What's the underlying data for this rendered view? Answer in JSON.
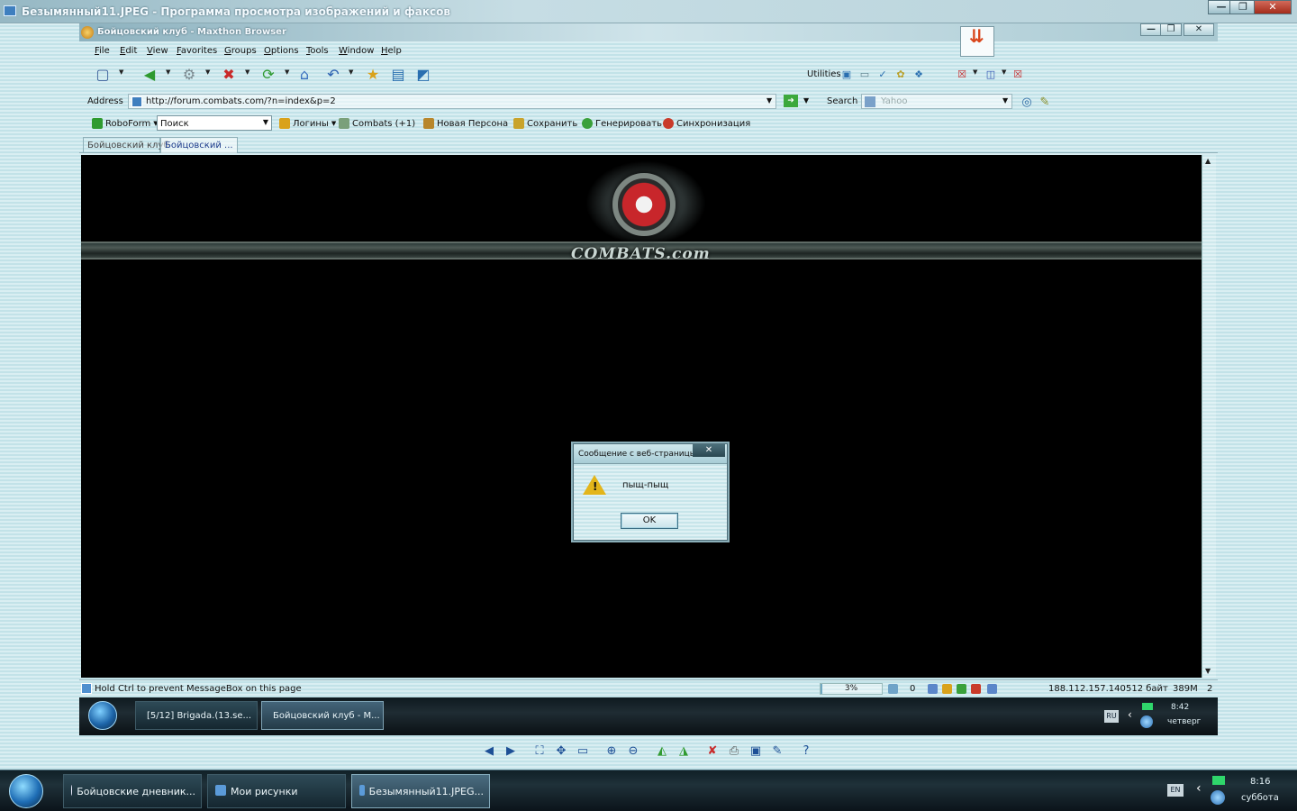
{
  "viewer": {
    "title": "Безымянный11.JPEG - Программа просмотра изображений и факсов",
    "controls": {
      "minimize": "—",
      "maximize": "❐",
      "close": "✕"
    }
  },
  "browser": {
    "title": "Бойцовский клуб - Maxthon Browser",
    "controls": {
      "minimize": "—",
      "maximize": "❐",
      "close": "✕"
    },
    "menu": [
      "File",
      "Edit",
      "View",
      "Favorites",
      "Groups",
      "Options",
      "Tools",
      "Window",
      "Help"
    ],
    "toolbar": {
      "utilities_label": "Utilities"
    },
    "address": {
      "label": "Address",
      "value": "http://forum.combats.com/?n=index&p=2"
    },
    "search": {
      "label": "Search",
      "engine": "Yahoo"
    },
    "links": {
      "roboform": "RoboForm",
      "roboform_search": "Поиск",
      "items": [
        "Логины",
        "Combats (+1)",
        "Новая Персона",
        "Сохранить",
        "Генерировать",
        "Синхронизация"
      ]
    },
    "tabs": [
      "Бойцовский клуб",
      "Бойцовский ..."
    ],
    "content": {
      "logo_text": "COMBATS.com"
    },
    "dialog": {
      "title": "Сообщение с веб-страницы",
      "message": "пыщ-пыщ",
      "ok_label": "OK",
      "close": "✕"
    },
    "status": {
      "text": "Hold Ctrl to prevent MessageBox on this page",
      "progress_percent": 3,
      "progress_label": "3%",
      "popup_count": "0",
      "ip": "188.112.157.140",
      "size": "512 байт",
      "memory": "389M",
      "tab_count": "2"
    }
  },
  "inner_taskbar": {
    "tasks": [
      "[5/12] Brigada.(13.se...",
      "Бойцовский клуб - M..."
    ],
    "lang": "RU",
    "time": "8:42",
    "day": "четверг"
  },
  "outer_taskbar": {
    "tasks": [
      "Бойцовские дневник...",
      "Мои рисунки",
      "Безымянный11.JPEG..."
    ],
    "lang": "EN",
    "time": "8:16",
    "day": "суббота"
  },
  "colors": {
    "accent": "#1d4f96",
    "content_bg": "#000000",
    "warning": "#e3b51a",
    "logo_red": "#c8262b"
  }
}
